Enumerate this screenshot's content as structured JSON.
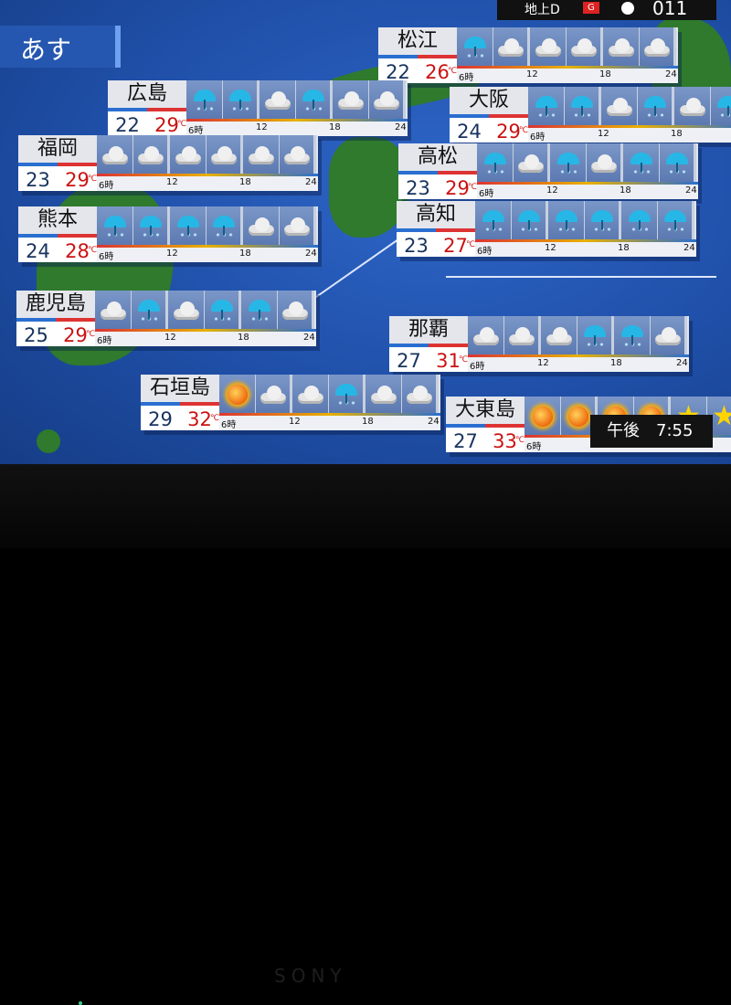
{
  "header": {
    "day_label": "あす"
  },
  "channel": {
    "label": "地上D",
    "badge": "G",
    "number": "011"
  },
  "clock": {
    "period": "午後",
    "time": "7:55"
  },
  "unit": "℃",
  "time_labels": [
    "6時",
    "12",
    "18",
    "24"
  ],
  "cities": [
    {
      "name": "松江",
      "low": "22",
      "high": "26",
      "icons": [
        "rain",
        "cloud",
        "cloud",
        "cloud",
        "cloud",
        "cloud"
      ]
    },
    {
      "name": "広島",
      "low": "22",
      "high": "29",
      "icons": [
        "rain",
        "rain",
        "cloud",
        "rain",
        "cloud",
        "cloud"
      ]
    },
    {
      "name": "大阪",
      "low": "24",
      "high": "29",
      "icons": [
        "rain",
        "rain",
        "cloud",
        "rain",
        "cloud",
        "rain"
      ]
    },
    {
      "name": "福岡",
      "low": "23",
      "high": "29",
      "icons": [
        "cloud",
        "cloud",
        "cloud",
        "cloud",
        "cloud",
        "cloud"
      ]
    },
    {
      "name": "高松",
      "low": "23",
      "high": "29",
      "icons": [
        "rain",
        "cloud",
        "rain",
        "cloud",
        "rain",
        "rain"
      ]
    },
    {
      "name": "熊本",
      "low": "24",
      "high": "28",
      "icons": [
        "rain",
        "rain",
        "rain",
        "rain",
        "cloud",
        "cloud"
      ]
    },
    {
      "name": "高知",
      "low": "23",
      "high": "27",
      "icons": [
        "rain",
        "rain",
        "rain",
        "rain",
        "rain",
        "rain"
      ]
    },
    {
      "name": "鹿児島",
      "low": "25",
      "high": "29",
      "icons": [
        "cloud",
        "rain",
        "cloud",
        "rain",
        "rain",
        "cloud"
      ]
    },
    {
      "name": "那覇",
      "low": "27",
      "high": "31",
      "icons": [
        "cloud",
        "cloud",
        "cloud",
        "rain",
        "rain",
        "cloud"
      ]
    },
    {
      "name": "石垣島",
      "low": "29",
      "high": "32",
      "icons": [
        "sun",
        "cloud",
        "cloud",
        "rain",
        "cloud",
        "cloud"
      ]
    },
    {
      "name": "大東島",
      "low": "27",
      "high": "33",
      "icons": [
        "sun",
        "sun",
        "sun",
        "sun",
        "star",
        "star"
      ]
    }
  ]
}
